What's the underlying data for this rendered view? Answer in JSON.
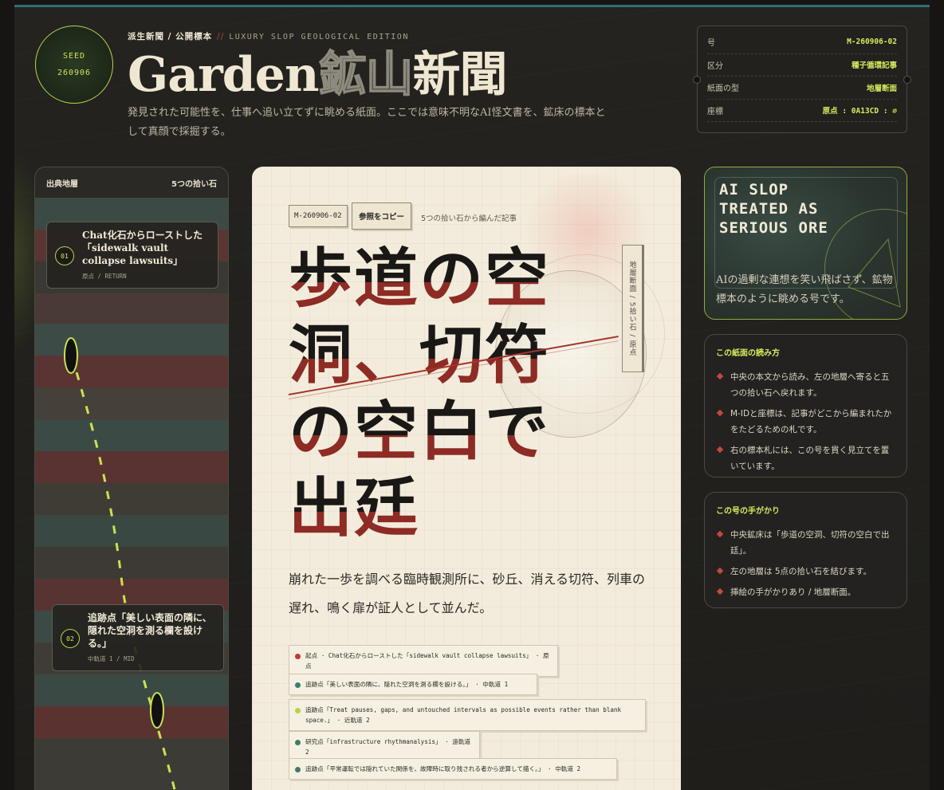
{
  "seed": {
    "label": "SEED",
    "code": "260906"
  },
  "header": {
    "kicker": "派生新聞 / 公開標本",
    "separator": "//",
    "edition": "LUXURY SLOP GEOLOGICAL EDITION",
    "title_a": "Garden",
    "title_b": "鉱山",
    "title_c": "新聞",
    "tagline": "発見された可能性を、仕事へ追い立てずに眺める紙面。ここでは意味不明なAI怪文書を、鉱床の標本として真顔で採掘する。"
  },
  "idcard": {
    "rows": [
      {
        "k": "号",
        "v": "M-260906-02"
      },
      {
        "k": "区分",
        "v": "種子循環記事"
      },
      {
        "k": "紙面の型",
        "v": "地層断面"
      },
      {
        "k": "座標",
        "v": "原点 : 0A13CD : ∅"
      }
    ]
  },
  "strata": {
    "head_left": "出典地層",
    "head_right": "5つの拾い石",
    "pebbles": [
      {
        "num": "01",
        "title": "Chat化石からローストした「sidewalk vault collapse lawsuits」",
        "meta": "原点 / RETURN"
      },
      {
        "num": "02",
        "title": "追跡点「美しい表面の隣に、隠れた空洞を測る欄を設ける。」",
        "meta": "中軌道 1 / MID"
      }
    ]
  },
  "article": {
    "id_chip": "M-260906-02",
    "copy_button": "参照をコピー",
    "meta_note": "5つの拾い石から編んだ記事",
    "vtag": "地層断面 / 5拾い石 / 原点",
    "headline": "歩道の空洞、切符の空白で出廷",
    "lede": "崩れた一歩を調べる臨時観測所に、砂丘、消える切符、列車の遅れ、鳴く扉が証人として並んだ。",
    "evidence": [
      {
        "text": "起点 · Chat化石からローストした「sidewalk vault collapse lawsuits」 · 原点",
        "color": "#c23a30"
      },
      {
        "text": "追跡点「美しい表面の隣に、隠れた空洞を測る欄を設ける。」 · 中軌道 1",
        "color": "#3f7a6d"
      },
      {
        "text": "追跡点「Treat pauses, gaps, and untouched intervals as possible events rather than blank space.」 · 近軌道 2",
        "color": "#b5d43f"
      },
      {
        "text": "研究点「infrastructure rhythmanalysis」 · 遠軌道 2",
        "color": "#3f7a6d"
      },
      {
        "text": "追跡点「平常運転では隠れていた関係を、故障時に取り残される者から逆算して描く。」 · 中軌道 2",
        "color": "#3f7a6d"
      }
    ]
  },
  "ore_card": {
    "title": "AI SLOP\nTREATED AS\nSERIOUS ORE",
    "desc": "AIの過剰な連想を笑い飛ばさず、鉱物標本のように眺める号です。"
  },
  "how_to_read": {
    "heading": "この紙面の読み方",
    "items": [
      "中央の本文から読み、左の地層へ寄ると五つの拾い石へ戻れます。",
      "M-IDと座標は、記事がどこから編まれたかをたどるための札です。",
      "右の標本札には、この号を貫く見立てを置いています。"
    ]
  },
  "clues": {
    "heading": "この号の手がかり",
    "items": [
      "中央鉱床は「歩道の空洞、切符の空白で出廷」。",
      "左の地層は 5点の拾い石を結びます。",
      "挿絵の手がかりあり / 地層断面。"
    ]
  }
}
